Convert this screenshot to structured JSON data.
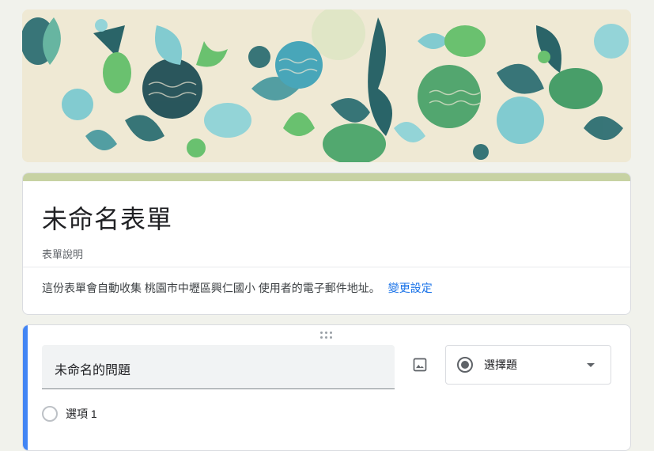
{
  "form": {
    "title": "未命名表單",
    "description": "表單說明",
    "collect_notice": "這份表單會自動收集 桃園市中壢區興仁國小 使用者的電子郵件地址。",
    "change_settings_link": "變更設定"
  },
  "question": {
    "title": "未命名的問題",
    "type_label": "選擇題",
    "options": [
      {
        "label": "選項 1"
      }
    ]
  },
  "colors": {
    "page_bg": "#f1f2ec",
    "header_accent": "#c7d2a3",
    "active_question_bar": "#4285f4",
    "link": "#1a73e8"
  },
  "icons": {
    "image": "image-icon",
    "radio": "radio-button-icon",
    "dropdown": "arrow-drop-down-icon",
    "drag": "drag-handle-icon"
  }
}
